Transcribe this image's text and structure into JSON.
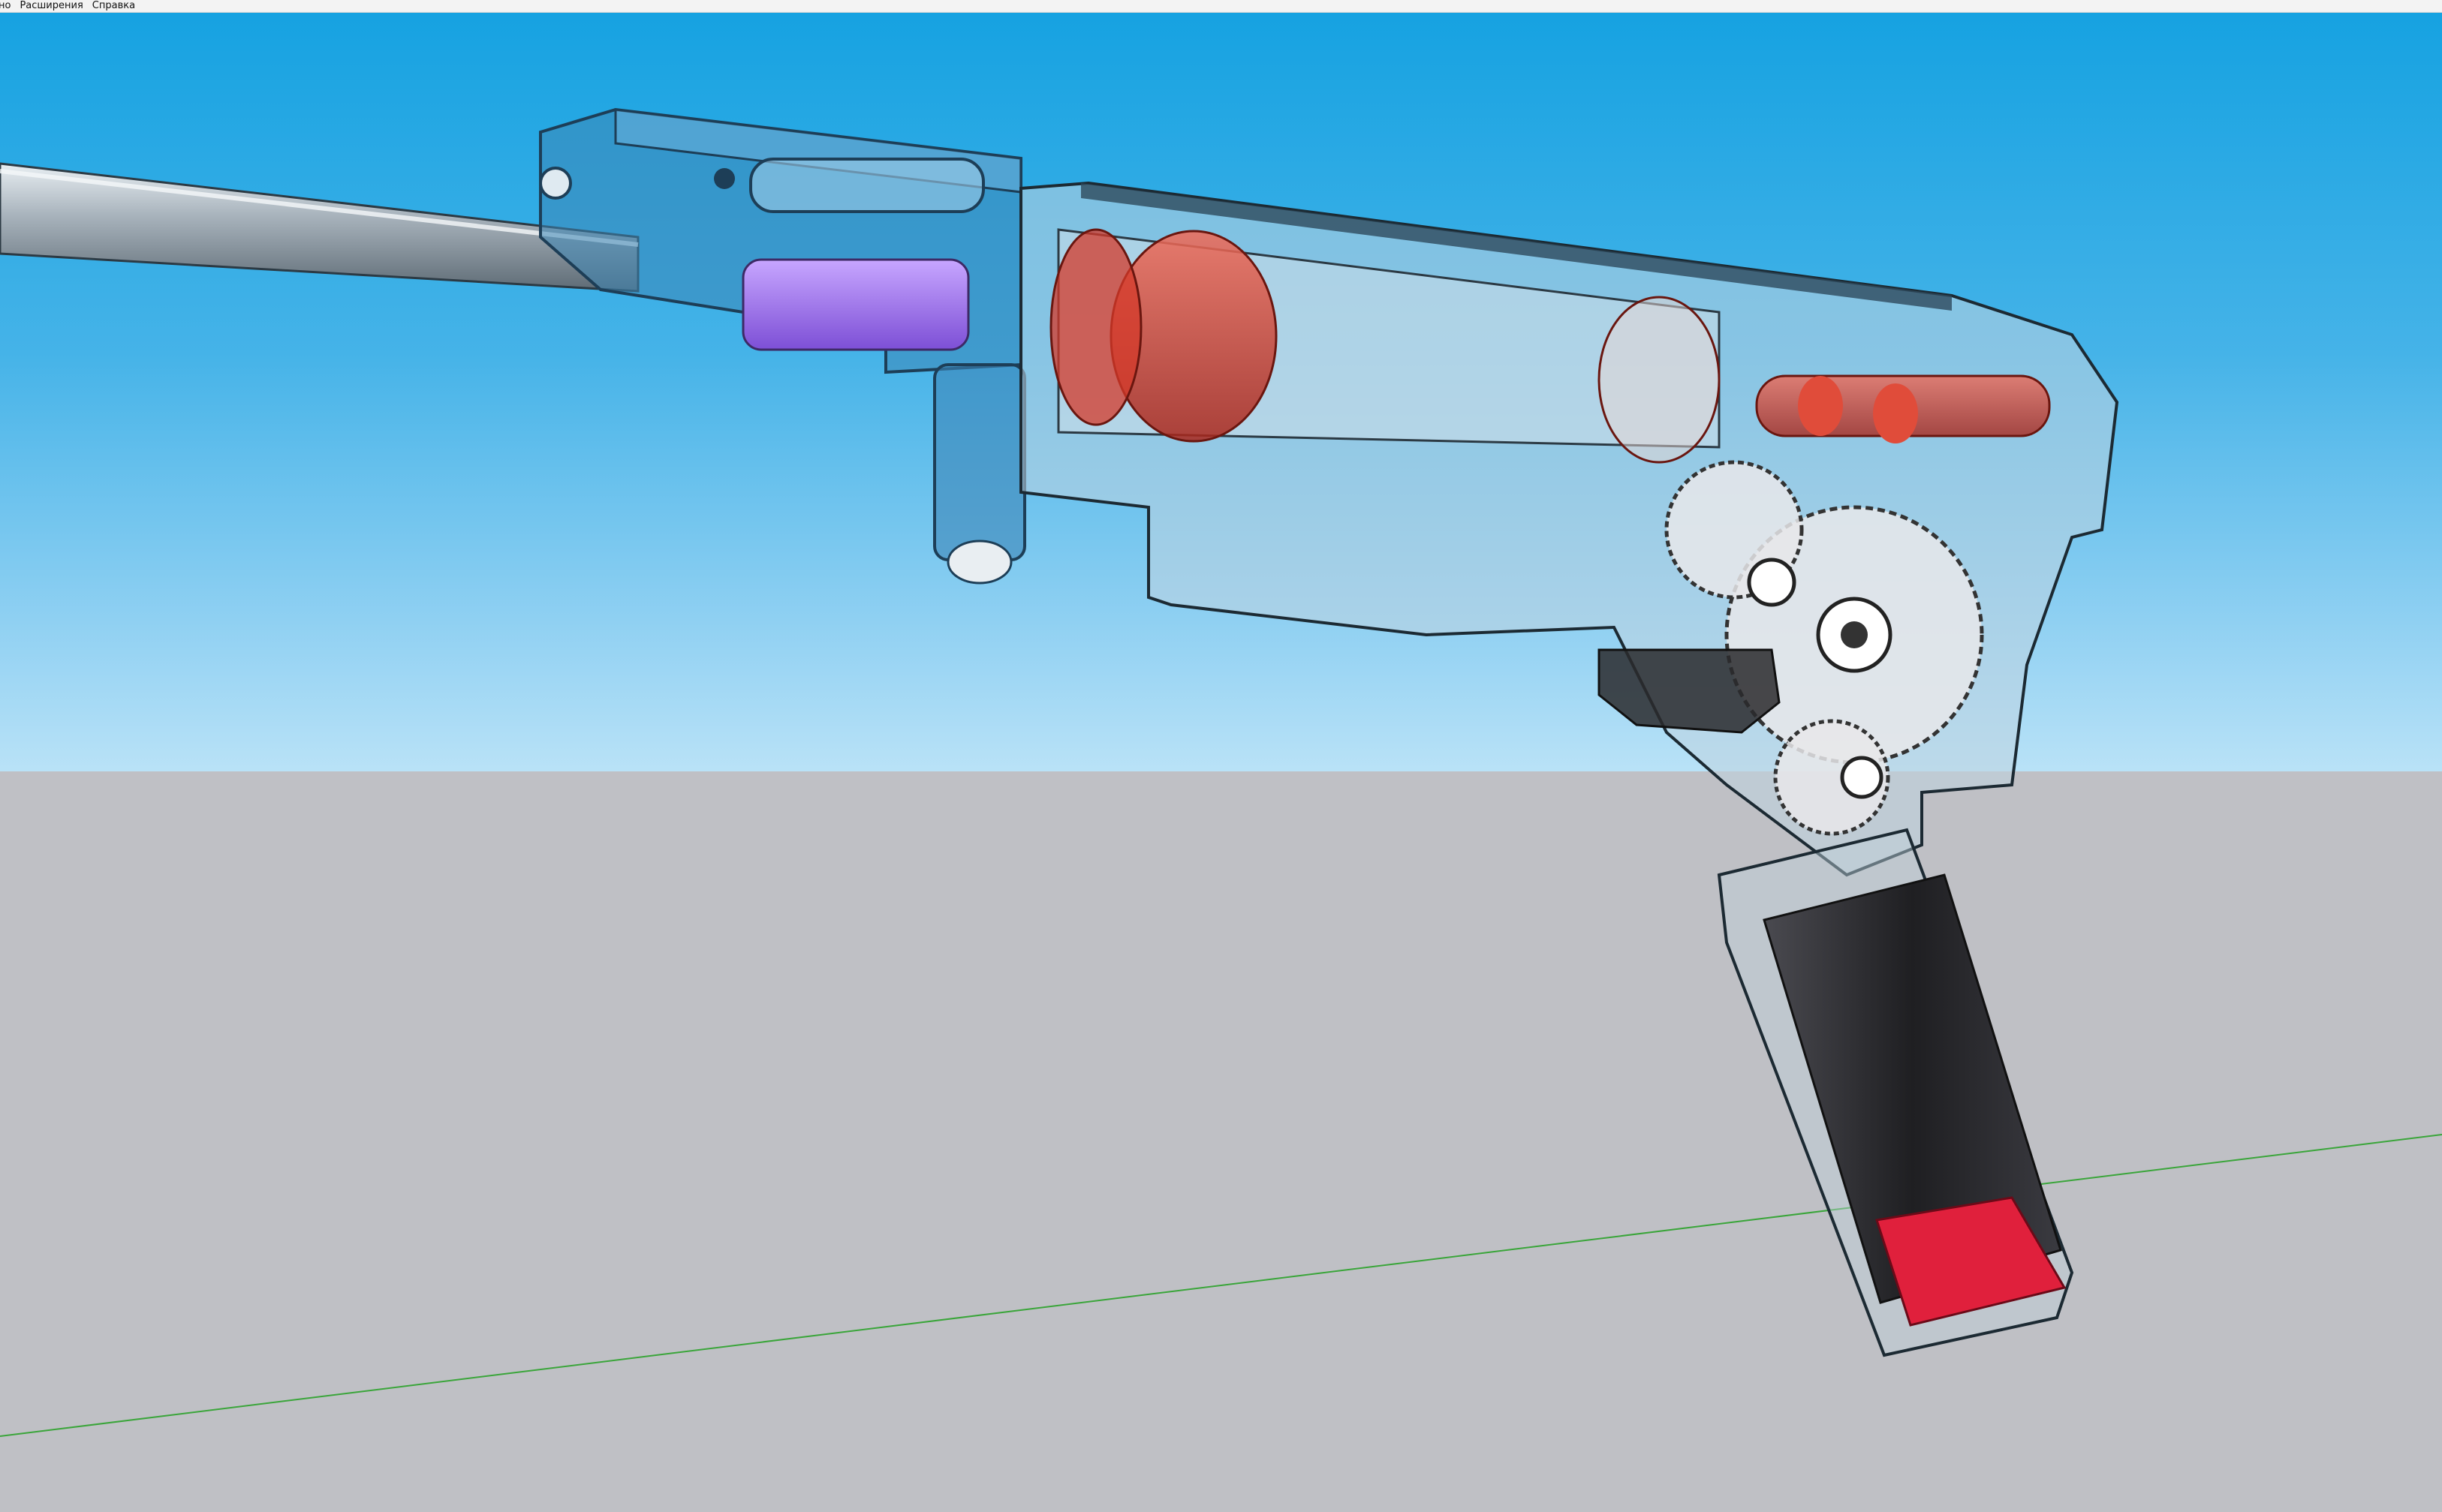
{
  "menubar": {
    "items": [
      {
        "label": "но"
      },
      {
        "label": "Расширения"
      },
      {
        "label": "Справка"
      }
    ]
  },
  "viewport": {
    "colors": {
      "sky_top": "#16a2e1",
      "sky_bottom": "#b9e2f7",
      "ground": "#bfc0c5",
      "green_axis": "#3aa53a",
      "barrel_block_blue": "#2f6f9e",
      "piston_red": "#d43a2a",
      "bucking_purple": "#9b6ae6",
      "motor_dark": "#2b2b2e",
      "motor_end_red": "#e0203c",
      "gear_white": "#e8e8ea"
    },
    "axes": [
      {
        "name": "green-axis",
        "color": "#3aa53a"
      }
    ]
  }
}
